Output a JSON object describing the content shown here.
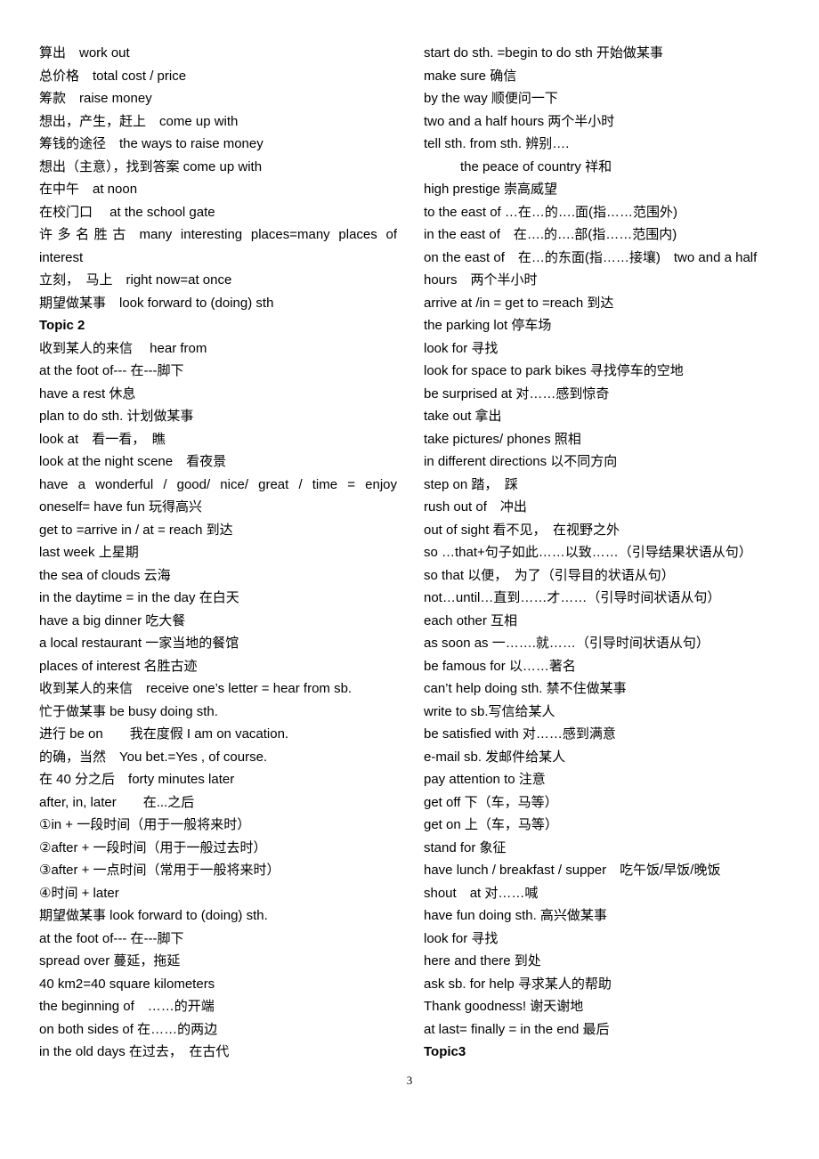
{
  "page": {
    "number": "3",
    "left_column": [
      {
        "text": "算出　work out"
      },
      {
        "text": "总价格　total cost / price"
      },
      {
        "text": "筹款　raise money"
      },
      {
        "text": "想出，产生，赶上　come up with"
      },
      {
        "text": "筹钱的途径　the ways to raise money"
      },
      {
        "text": "想出（主意），找到答案  come up with"
      },
      {
        "text": "在中午　at noon"
      },
      {
        "text": "在校门口　  at the school gate"
      },
      {
        "text": "许多名胜古 many interesting places=many places of",
        "justify": true
      },
      {
        "text": "interest"
      },
      {
        "text": "立刻，　马上　right now=at once"
      },
      {
        "text": "期望做某事　look forward to (doing) sth"
      },
      {
        "text": "Topic 2",
        "bold": true
      },
      {
        "text": "收到某人的来信　  hear from"
      },
      {
        "text": "at the foot of---  在---脚下"
      },
      {
        "text": "have a rest  休息"
      },
      {
        "text": "plan to do sth.  计划做某事"
      },
      {
        "text": "look at　看一看，　瞧"
      },
      {
        "text": "look at the night scene　看夜景"
      },
      {
        "text": "have a wonderful / good/ nice/ great / time = enjoy",
        "justify": true
      },
      {
        "text": "oneself= have fun  玩得高兴"
      },
      {
        "text": "get to =arrive in / at = reach  到达"
      },
      {
        "text": "last week  上星期"
      },
      {
        "text": "the sea of clouds  云海"
      },
      {
        "text": "in the daytime = in the day  在白天"
      },
      {
        "text": "have a big dinner  吃大餐"
      },
      {
        "text": "a local restaurant  一家当地的餐馆"
      },
      {
        "text": "places of interest  名胜古迹"
      },
      {
        "text": "收到某人的来信　receive one’s letter = hear from sb."
      },
      {
        "text": "忙于做某事  be busy doing sth."
      },
      {
        "text": "进行 be on　　我在度假 I am on vacation."
      },
      {
        "text": "的确，当然　You bet.=Yes , of course."
      },
      {
        "text": "在 40 分之后　forty minutes later"
      },
      {
        "text": "after, in, later　　在...之后"
      },
      {
        "text": "①in +  一段时间（用于一般将来时）"
      },
      {
        "text": "②after +  一段时间（用于一般过去时）"
      },
      {
        "text": "③after +  一点时间（常用于一般将来时）"
      },
      {
        "text": "④时间  + later"
      },
      {
        "text": "期望做某事  look forward to (doing) sth."
      },
      {
        "text": "at the foot of---  在---脚下"
      },
      {
        "text": "spread over  蔓延，拖延"
      },
      {
        "text": "40 km2=40 square kilometers"
      },
      {
        "text": "the beginning of　……的开端"
      },
      {
        "text": "on both sides of  在……的两边"
      },
      {
        "text": "in the old days  在过去，　在古代"
      }
    ],
    "right_column": [
      {
        "text": "start do sth. =begin to do sth  开始做某事"
      },
      {
        "text": "make sure  确信"
      },
      {
        "text": "by the way  顺便问一下"
      },
      {
        "text": "two and a half hours  两个半小时"
      },
      {
        "text": "tell sth. from sth.  辨别…."
      },
      {
        "text": "the peace of country  祥和",
        "indent": true
      },
      {
        "text": "high prestige  崇高威望"
      },
      {
        "text": "to the east of …在…的….面(指……范围外)"
      },
      {
        "text": "in the east of　在….的….部(指……范围内)"
      },
      {
        "text": "on the east of　在…的东面(指……接壤)　two and a half"
      },
      {
        "text": "hours　两个半小时"
      },
      {
        "text": "arrive at /in = get to =reach  到达"
      },
      {
        "text": "the parking lot  停车场"
      },
      {
        "text": "look for  寻找"
      },
      {
        "text": "look for space to park bikes 寻找停车的空地"
      },
      {
        "text": "be surprised at  对……感到惊奇"
      },
      {
        "text": "take out  拿出"
      },
      {
        "text": "take pictures/ phones 照相"
      },
      {
        "text": "in different directions  以不同方向"
      },
      {
        "text": "step on  踏，　踩"
      },
      {
        "text": "rush out of　冲出"
      },
      {
        "text": "out of sight  看不见，　在视野之外"
      },
      {
        "text": "so …that+句子如此……以致……（引导结果状语从句）"
      },
      {
        "text": "so that  以便，　为了（引导目的状语从句）"
      },
      {
        "text": "not…until…直到……才……（引导时间状语从句）"
      },
      {
        "text": "each other  互相"
      },
      {
        "text": "as soon as 一…….就……（引导时间状语从句）"
      },
      {
        "text": "be famous for  以……著名"
      },
      {
        "text": "can’t help doing sth.  禁不住做某事"
      },
      {
        "text": "write to sb.写信给某人"
      },
      {
        "text": "be satisfied with  对……感到满意"
      },
      {
        "text": "e-mail sb.  发邮件给某人"
      },
      {
        "text": "pay attention to  注意"
      },
      {
        "text": "get off  下（车，马等）"
      },
      {
        "text": "get on  上（车，马等）"
      },
      {
        "text": "stand for  象征"
      },
      {
        "text": "have lunch / breakfast / supper　吃午饭/早饭/晚饭"
      },
      {
        "text": "shout　at  对……喊"
      },
      {
        "text": "have fun doing sth.  高兴做某事"
      },
      {
        "text": "look for  寻找"
      },
      {
        "text": "here and there  到处"
      },
      {
        "text": "ask sb. for help  寻求某人的帮助"
      },
      {
        "text": "Thank goodness!  谢天谢地"
      },
      {
        "text": "at last= finally = in the end  最后"
      },
      {
        "text": "Topic3",
        "bold": true
      }
    ]
  }
}
